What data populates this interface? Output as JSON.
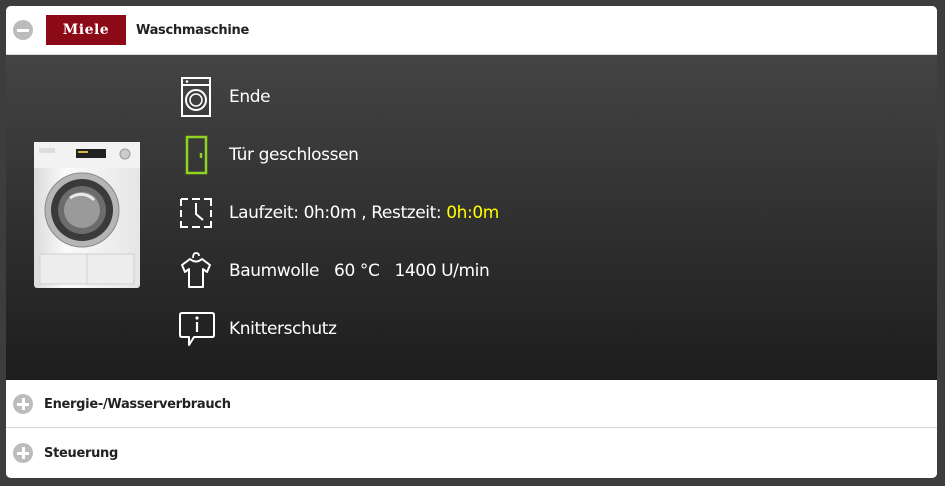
{
  "header": {
    "logo": "Miele",
    "title": "Waschmaschine"
  },
  "status": {
    "program_state": "Ende",
    "door": "Tür geschlossen",
    "laufzeit_label": "Laufzeit: ",
    "laufzeit_value": "0h:0m",
    "separator": " , ",
    "restzeit_label": "Restzeit: ",
    "restzeit_value": "0h:0m",
    "program": "Baumwolle   60 °C   1400 U/min",
    "info": "Knitterschutz"
  },
  "sections": [
    {
      "label": "Energie-/Wasserverbrauch"
    },
    {
      "label": "Steuerung"
    }
  ],
  "colors": {
    "brand": "#8c0a18",
    "door_closed": "#8ed420",
    "highlight": "#ffff00"
  }
}
